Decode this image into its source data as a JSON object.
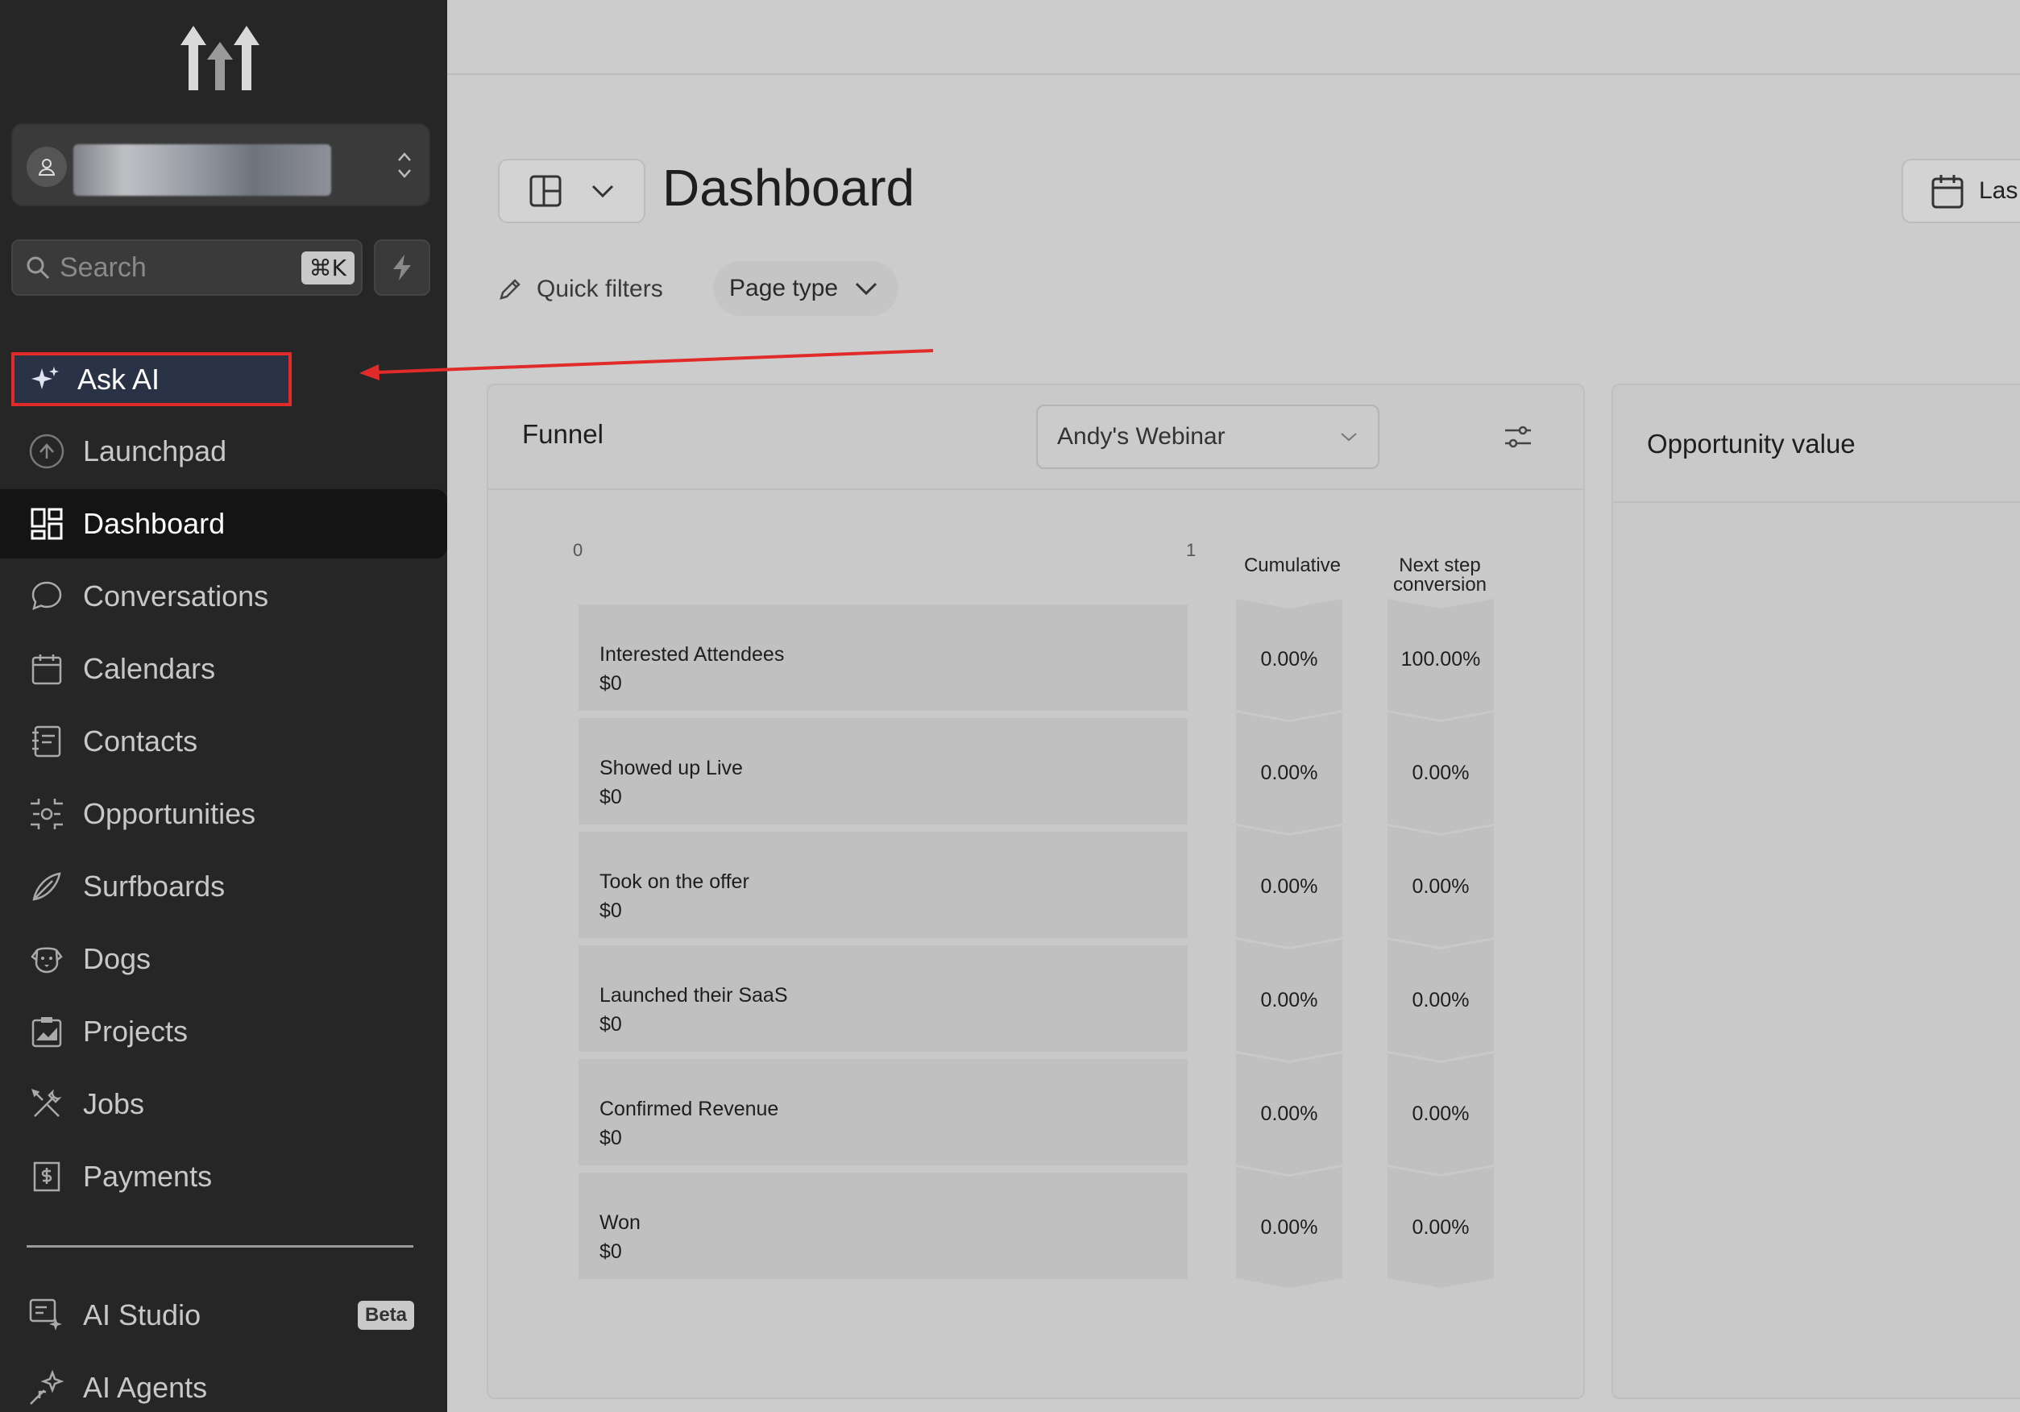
{
  "sidebar": {
    "search": {
      "placeholder": "Search",
      "shortcut": "⌘K"
    },
    "ask_ai": "Ask AI",
    "items": [
      {
        "label": "Launchpad",
        "icon": "launchpad-icon"
      },
      {
        "label": "Dashboard",
        "icon": "dashboard-grid-icon",
        "active": true
      },
      {
        "label": "Conversations",
        "icon": "chat-bubble-icon"
      },
      {
        "label": "Calendars",
        "icon": "calendar-icon"
      },
      {
        "label": "Contacts",
        "icon": "contacts-book-icon"
      },
      {
        "label": "Opportunities",
        "icon": "opportunities-icon"
      },
      {
        "label": "Surfboards",
        "icon": "surfboard-icon"
      },
      {
        "label": "Dogs",
        "icon": "dog-icon"
      },
      {
        "label": "Projects",
        "icon": "projects-icon"
      },
      {
        "label": "Jobs",
        "icon": "tools-icon"
      },
      {
        "label": "Payments",
        "icon": "receipt-icon"
      }
    ],
    "bottom_items": [
      {
        "label": "AI Studio",
        "icon": "ai-studio-icon",
        "badge": "Beta"
      },
      {
        "label": "AI Agents",
        "icon": "sparkle-icon"
      }
    ]
  },
  "header": {
    "title": "Dashboard",
    "date_button": "Las",
    "quick_filters": "Quick filters",
    "page_type": "Page type"
  },
  "funnel": {
    "title": "Funnel",
    "selected": "Andy's Webinar",
    "axis_min": "0",
    "axis_max": "1",
    "col_cumulative": "Cumulative",
    "col_next_1": "Next step",
    "col_next_2": "conversion",
    "stages": [
      {
        "name": "Interested Attendees",
        "value": "$0",
        "cumulative": "0.00%",
        "next": "100.00%"
      },
      {
        "name": "Showed up Live",
        "value": "$0",
        "cumulative": "0.00%",
        "next": "0.00%"
      },
      {
        "name": "Took on the offer",
        "value": "$0",
        "cumulative": "0.00%",
        "next": "0.00%"
      },
      {
        "name": "Launched their SaaS",
        "value": "$0",
        "cumulative": "0.00%",
        "next": "0.00%"
      },
      {
        "name": "Confirmed Revenue",
        "value": "$0",
        "cumulative": "0.00%",
        "next": "0.00%"
      },
      {
        "name": "Won",
        "value": "$0",
        "cumulative": "0.00%",
        "next": "0.00%"
      }
    ]
  },
  "opportunity": {
    "title": "Opportunity value"
  },
  "colors": {
    "highlight_box": "#e12a2a",
    "sidebar_bg": "#262626",
    "active_item_bg": "#141414"
  }
}
